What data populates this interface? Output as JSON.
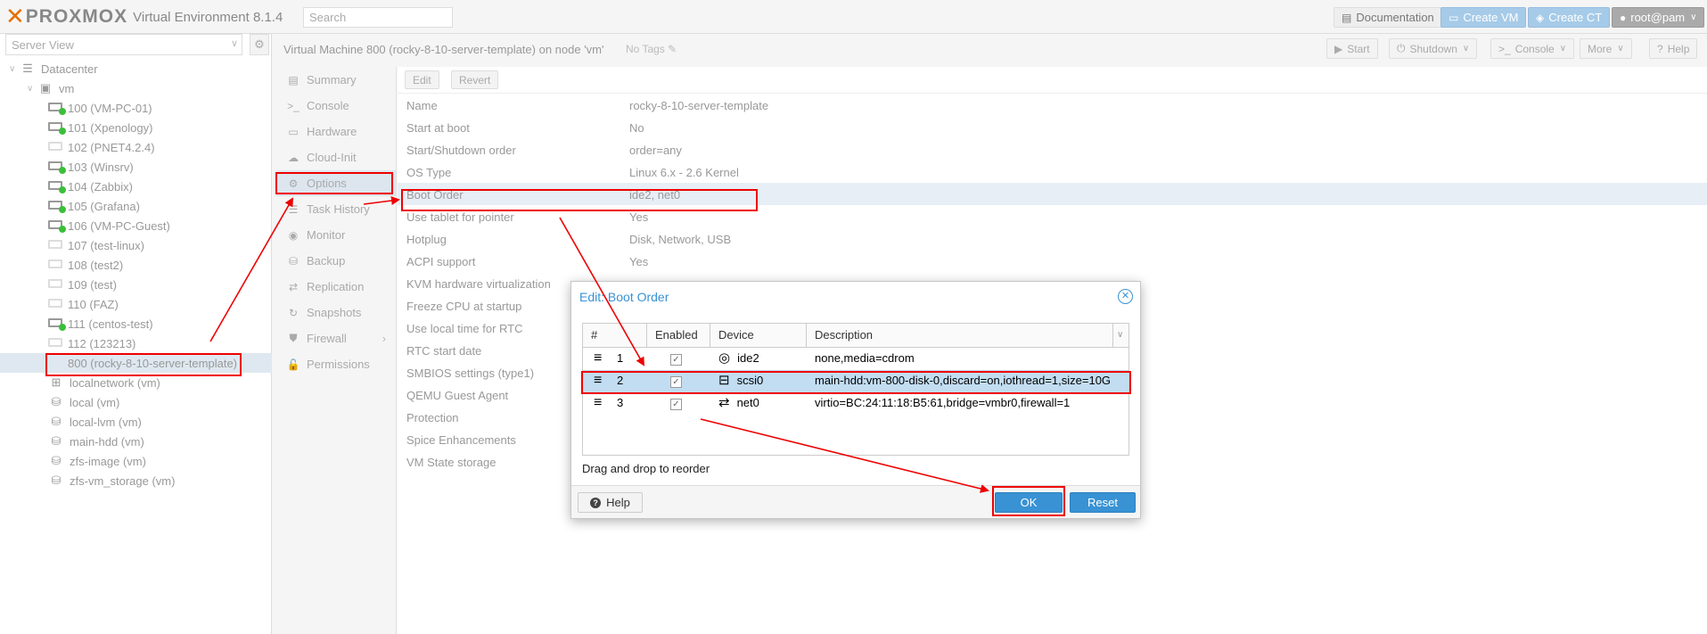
{
  "topbar": {
    "brand": "PROXMOX",
    "version": "Virtual Environment 8.1.4",
    "search_placeholder": "Search",
    "documentation": "Documentation",
    "create_vm": "Create VM",
    "create_ct": "Create CT",
    "user": "root@pam"
  },
  "left": {
    "view": "Server View",
    "tree": [
      {
        "label": "Datacenter",
        "icon": "datacenter-icon"
      },
      {
        "label": "vm",
        "icon": "node-icon"
      },
      {
        "label": "100 (VM-PC-01)",
        "running": true
      },
      {
        "label": "101 (Xpenology)",
        "running": true
      },
      {
        "label": "102 (PNET4.2.4)",
        "running": false
      },
      {
        "label": "103 (Winsrv)",
        "running": true
      },
      {
        "label": "104 (Zabbix)",
        "running": true
      },
      {
        "label": "105 (Grafana)",
        "running": true
      },
      {
        "label": "106 (VM-PC-Guest)",
        "running": true
      },
      {
        "label": "107 (test-linux)",
        "running": false
      },
      {
        "label": "108 (test2)",
        "running": false
      },
      {
        "label": "109 (test)",
        "running": false
      },
      {
        "label": "110 (FAZ)",
        "running": false
      },
      {
        "label": "111 (centos-test)",
        "running": true
      },
      {
        "label": "112 (123213)",
        "running": false
      },
      {
        "label": "800 (rocky-8-10-server-template)",
        "template": true
      },
      {
        "label": "localnetwork (vm)",
        "icon": "network-icon"
      },
      {
        "label": "local (vm)",
        "icon": "storage-icon"
      },
      {
        "label": "local-lvm (vm)",
        "icon": "storage-icon"
      },
      {
        "label": "main-hdd (vm)",
        "icon": "storage-icon"
      },
      {
        "label": "zfs-image (vm)",
        "icon": "storage-icon"
      },
      {
        "label": "zfs-vm_storage (vm)",
        "icon": "storage-icon"
      }
    ]
  },
  "header": {
    "title": "Virtual Machine 800 (rocky-8-10-server-template) on node 'vm'",
    "tags": "No Tags",
    "start": "Start",
    "shutdown": "Shutdown",
    "console": "Console",
    "more": "More",
    "help": "Help"
  },
  "nav": [
    {
      "label": "Summary",
      "icon": "summary-icon"
    },
    {
      "label": "Console",
      "icon": "console-icon"
    },
    {
      "label": "Hardware",
      "icon": "hardware-icon"
    },
    {
      "label": "Cloud-Init",
      "icon": "cloud-icon"
    },
    {
      "label": "Options",
      "icon": "gear-icon",
      "active": true
    },
    {
      "label": "Task History",
      "icon": "list-icon"
    },
    {
      "label": "Monitor",
      "icon": "eye-icon"
    },
    {
      "label": "Backup",
      "icon": "backup-icon"
    },
    {
      "label": "Replication",
      "icon": "replication-icon"
    },
    {
      "label": "Snapshots",
      "icon": "history-icon"
    },
    {
      "label": "Firewall",
      "icon": "shield-icon"
    },
    {
      "label": "Permissions",
      "icon": "unlock-icon"
    }
  ],
  "options": {
    "edit": "Edit",
    "revert": "Revert",
    "rows": [
      {
        "key": "Name",
        "value": "rocky-8-10-server-template"
      },
      {
        "key": "Start at boot",
        "value": "No"
      },
      {
        "key": "Start/Shutdown order",
        "value": "order=any"
      },
      {
        "key": "OS Type",
        "value": "Linux 6.x - 2.6 Kernel"
      },
      {
        "key": "Boot Order",
        "value": "ide2, net0"
      },
      {
        "key": "Use tablet for pointer",
        "value": "Yes"
      },
      {
        "key": "Hotplug",
        "value": "Disk, Network, USB"
      },
      {
        "key": "ACPI support",
        "value": "Yes"
      },
      {
        "key": "KVM hardware virtualization",
        "value": ""
      },
      {
        "key": "Freeze CPU at startup",
        "value": ""
      },
      {
        "key": "Use local time for RTC",
        "value": ""
      },
      {
        "key": "RTC start date",
        "value": ""
      },
      {
        "key": "SMBIOS settings (type1)",
        "value": ""
      },
      {
        "key": "QEMU Guest Agent",
        "value": ""
      },
      {
        "key": "Protection",
        "value": ""
      },
      {
        "key": "Spice Enhancements",
        "value": ""
      },
      {
        "key": "VM State storage",
        "value": ""
      }
    ]
  },
  "dialog": {
    "title": "Edit: Boot Order",
    "columns": [
      "#",
      "Enabled",
      "Device",
      "Description"
    ],
    "rows": [
      {
        "num": "1",
        "enabled": true,
        "device": "ide2",
        "device_icon": "cdrom-icon",
        "description": "none,media=cdrom"
      },
      {
        "num": "2",
        "enabled": true,
        "device": "scsi0",
        "device_icon": "harddisk-icon",
        "description": "main-hdd:vm-800-disk-0,discard=on,iothread=1,size=10G",
        "selected": true
      },
      {
        "num": "3",
        "enabled": true,
        "device": "net0",
        "device_icon": "network-exchange-icon",
        "description": "virtio=BC:24:11:18:B5:61,bridge=vmbr0,firewall=1"
      }
    ],
    "hint": "Drag and drop to reorder",
    "help": "Help",
    "ok": "OK",
    "reset": "Reset"
  },
  "colors": {
    "accent": "#3892d4",
    "annotation": "#e00000",
    "selection": "#c2ddf2"
  }
}
